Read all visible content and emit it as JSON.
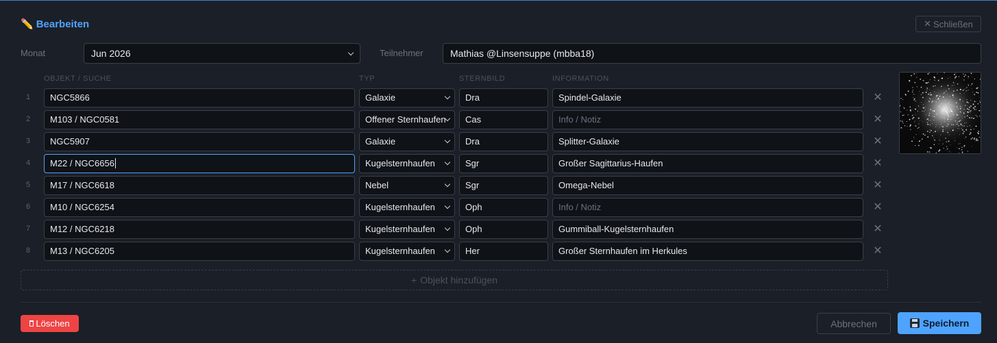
{
  "header": {
    "title": "Bearbeiten",
    "title_icon": "pencil-icon",
    "close_label": "Schließen"
  },
  "meta": {
    "month_label": "Monat",
    "month_value": "Jun 2026",
    "participant_label": "Teilnehmer",
    "participant_value": "Mathias @Linsensuppe (mbba18)"
  },
  "columns": {
    "object": "OBJEKT / SUCHE",
    "type": "TYP",
    "constellation": "STERNBILD",
    "info": "INFORMATION"
  },
  "info_placeholder": "Info / Notiz",
  "rows": [
    {
      "num": "1",
      "object": "NGC5866",
      "type": "Galaxie",
      "constellation": "Dra",
      "info": "Spindel-Galaxie"
    },
    {
      "num": "2",
      "object": "M103 / NGC0581",
      "type": "Offener Sternhaufen",
      "constellation": "Cas",
      "info": ""
    },
    {
      "num": "3",
      "object": "NGC5907",
      "type": "Galaxie",
      "constellation": "Dra",
      "info": "Splitter-Galaxie"
    },
    {
      "num": "4",
      "object": "M22 / NGC6656",
      "type": "Kugelsternhaufen",
      "constellation": "Sgr",
      "info": "Großer Sagittarius-Haufen"
    },
    {
      "num": "5",
      "object": "M17 / NGC6618",
      "type": "Nebel",
      "constellation": "Sgr",
      "info": "Omega-Nebel"
    },
    {
      "num": "6",
      "object": "M10 / NGC6254",
      "type": "Kugelsternhaufen",
      "constellation": "Oph",
      "info": ""
    },
    {
      "num": "7",
      "object": "M12 / NGC6218",
      "type": "Kugelsternhaufen",
      "constellation": "Oph",
      "info": "Gummiball-Kugelsternhaufen"
    },
    {
      "num": "8",
      "object": "M13 / NGC6205",
      "type": "Kugelsternhaufen",
      "constellation": "Her",
      "info": "Großer Sternhaufen im Herkules"
    }
  ],
  "add_object_label": "Objekt hinzufügen",
  "footer": {
    "delete_label": "Löschen",
    "cancel_label": "Abbrechen",
    "save_label": "Speichern"
  },
  "colors": {
    "background": "#1b1f27",
    "accent": "#4ea3ff",
    "danger": "#ef4444",
    "input_bg": "#0f1217",
    "border": "#3a3f49"
  }
}
